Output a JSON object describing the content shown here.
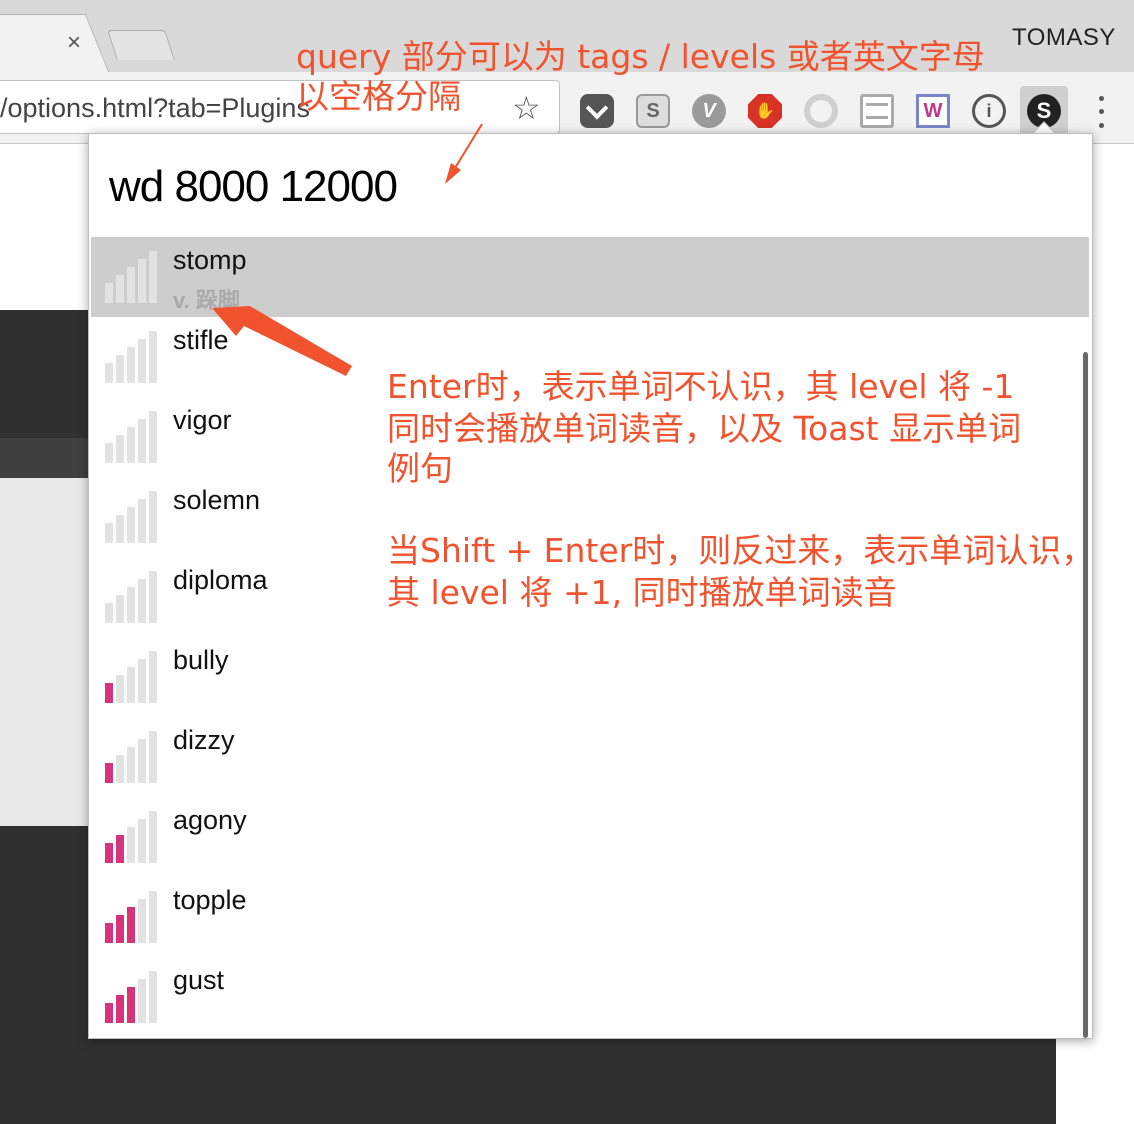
{
  "browser": {
    "tab_close": "×",
    "profile_name": "TOMASY",
    "url": "/options.html?tab=Plugins",
    "extensions": [
      "pocket-icon",
      "s-extension-icon",
      "v-extension-icon",
      "stop-hand-icon",
      "swirl-icon",
      "reader-icon",
      "w-extension-icon",
      "info-circle-icon",
      "shanbay-s-icon",
      "menu-icon"
    ]
  },
  "popup": {
    "query": "wd 8000 12000",
    "items": [
      {
        "word": "stomp",
        "translation": "v. 跺脚",
        "level": 0,
        "selected": true,
        "trans_shown": "ifcbf"
      },
      {
        "word": "stifle",
        "level": 0
      },
      {
        "word": "vigor",
        "level": 0
      },
      {
        "word": "solemn",
        "level": 0
      },
      {
        "word": "diploma",
        "level": 0
      },
      {
        "word": "bully",
        "level": 1
      },
      {
        "word": "dizzy",
        "level": 1
      },
      {
        "word": "agony",
        "level": 2
      },
      {
        "word": "topple",
        "level": 3
      },
      {
        "word": "gust",
        "level": 3
      }
    ]
  },
  "annotations": {
    "query_line1": "query 部分可以为 tags / levels 或者英文字母",
    "query_line2": "以空格分隔",
    "enter_lines": [
      "Enter时，表示单词不认识，其 level 将 -1",
      "同时会播放单词读音，以及 Toast 显示单词",
      "例句",
      "",
      "当Shift + Enter时，则反过来，表示单词认识，",
      "其 level 将 +1, 同时播放单词读音"
    ]
  },
  "colors": {
    "bar_active": "#d6357d",
    "bar_inactive": "#e2e2e2",
    "annotation": "#f0532d",
    "selected_row": "#cdcdcd"
  }
}
